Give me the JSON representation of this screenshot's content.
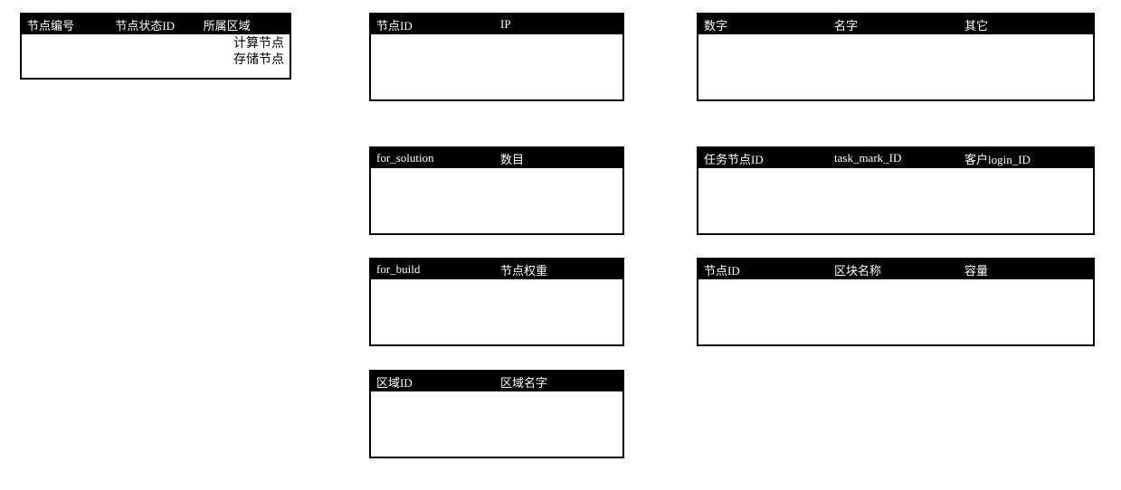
{
  "left_box": {
    "header_cols": [
      "节点编号",
      "节点状态ID",
      "所属区域"
    ],
    "rows": [
      "计算节点",
      "存储节点"
    ]
  },
  "mid_boxes": [
    {
      "header_cols": [
        "节点ID",
        "IP"
      ]
    },
    {
      "header_cols": [
        "for_solution",
        "数目"
      ]
    },
    {
      "header_cols": [
        "for_build",
        "节点权重"
      ]
    },
    {
      "header_cols": [
        "区域ID",
        "区域名字"
      ]
    }
  ],
  "right_boxes": [
    {
      "header_cols": [
        "数字",
        "名字",
        "其它"
      ]
    },
    {
      "header_cols": [
        "任务节点ID",
        "task_mark_ID",
        "客户login_ID"
      ]
    },
    {
      "header_cols": [
        "节点ID",
        "区块名称",
        "容量"
      ]
    }
  ]
}
